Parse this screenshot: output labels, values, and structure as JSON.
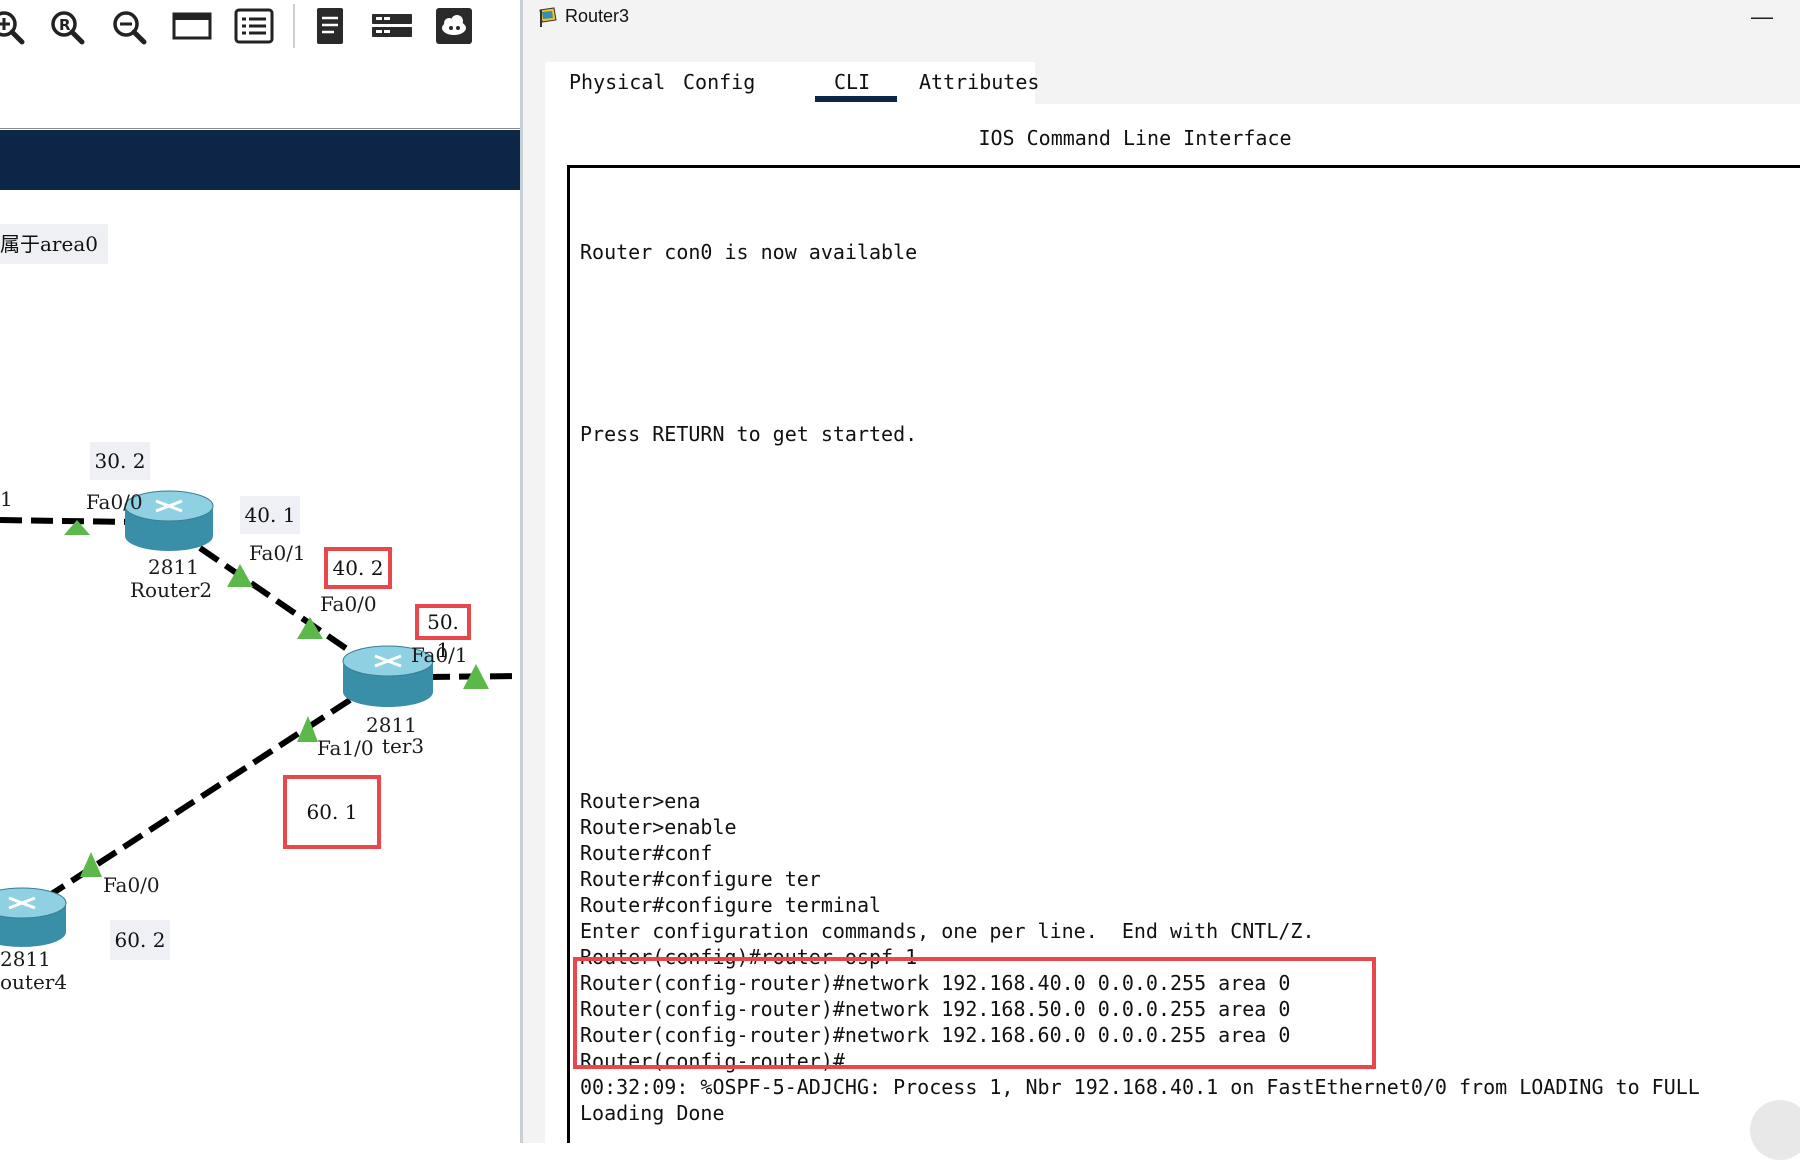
{
  "workspace": {
    "toolbar": {
      "icons": [
        "zoom-in-icon",
        "zoom-reset-icon",
        "zoom-out-icon",
        "window-icon",
        "list-icon",
        "document-icon",
        "switch-device-icon",
        "cloud-device-icon"
      ]
    },
    "area_note": "属于area0",
    "labels": {
      "left_link": "1",
      "r2_ip_fa00": "30. 2",
      "r2_fa00": "Fa0/0",
      "r2_ip_fa01": "40. 1",
      "r2_fa01": "Fa0/1",
      "r2_model": "2811",
      "r2_name": "Router2",
      "r3_ip_fa00": "40. 2",
      "r3_fa00": "Fa0/0",
      "r3_ip_fa01": "50. 1",
      "r3_fa01": "Fa0/1",
      "r3_model": "2811",
      "r3_fa10": "Fa1/0",
      "r3_name_partial": "ter3",
      "r3_ip_fa10": "60. 1",
      "r4_fa00": "Fa0/0",
      "r4_ip": "60. 2",
      "r4_model": "2811",
      "r4_name_partial": "outer4"
    }
  },
  "window": {
    "title": "Router3",
    "minimize_glyph": "—",
    "tabs": [
      {
        "label": "Physical"
      },
      {
        "label": "Config"
      },
      {
        "label": "CLI",
        "active": true
      },
      {
        "label": "Attributes"
      }
    ],
    "cli_heading": "IOS Command Line Interface",
    "terminal_lines": [
      "Router con0 is now available",
      "Press RETURN to get started.",
      "Router>ena",
      "Router>enable",
      "Router#conf",
      "Router#configure ter",
      "Router#configure terminal",
      "Enter configuration commands, one per line.  End with CNTL/Z.",
      "Router(config)#router ospf 1",
      "Router(config-router)#network 192.168.40.0 0.0.0.255 area 0",
      "Router(config-router)#network 192.168.50.0 0.0.0.255 area 0",
      "Router(config-router)#network 192.168.60.0 0.0.0.255 area 0",
      "Router(config-router)#",
      "00:32:09: %OSPF-5-ADJCHG: Process 1, Nbr 192.168.40.1 on FastEthernet0/0 from LOADING to FULL",
      "Loading Done"
    ]
  },
  "colors": {
    "navy": "#0d2547",
    "highlight_red": "#e8474b",
    "link_green": "#5cb84a"
  }
}
